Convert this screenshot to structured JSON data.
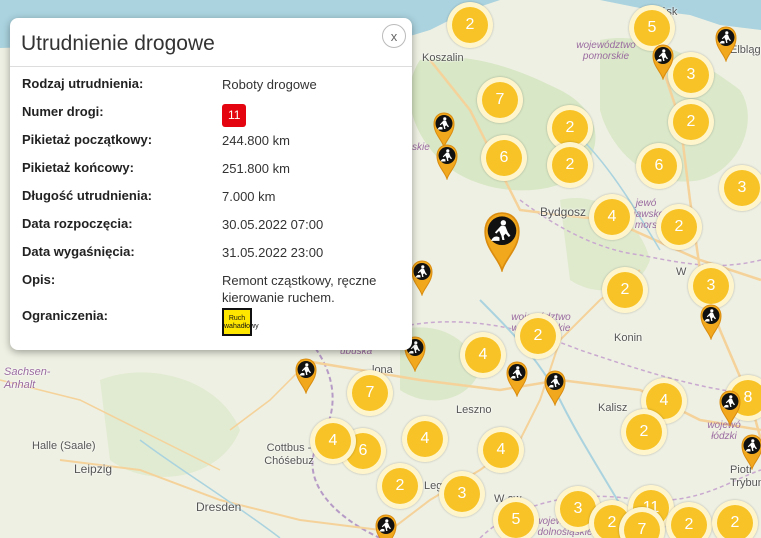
{
  "popup": {
    "title": "Utrudnienie drogowe",
    "close_label": "x",
    "rows": {
      "type_label": "Rodzaj utrudnienia:",
      "type_value": "Roboty drogowe",
      "road_label": "Numer drogi:",
      "road_value": "11",
      "start_km_label": "Pikietaż początkowy:",
      "start_km_value": "244.800 km",
      "end_km_label": "Pikietaż końcowy:",
      "end_km_value": "251.800 km",
      "length_label": "Długość utrudnienia:",
      "length_value": "7.000 km",
      "start_date_label": "Data rozpoczęcia:",
      "start_date_value": "30.05.2022 07:00",
      "end_date_label": "Data wygaśnięcia:",
      "end_date_value": "31.05.2022 23:00",
      "desc_label": "Opis:",
      "desc_value": "Remont cząstkowy, ręczne kierowanie ruchem.",
      "restrictions_label": "Ograniczenia:",
      "restrictions_sign_text": "Ruch wahadłowy"
    }
  },
  "places": {
    "gdansk": "dańsk",
    "elblag": "Elbląg",
    "koszalin": "Koszalin",
    "bydgoszcz": "Bydgosz",
    "konin": "Konin",
    "kalisz": "Kalisz",
    "leszno": "Leszno",
    "zielona": "lona",
    "cottbus": "Cottbus - Chóśebuz",
    "halle": "Halle (Saale)",
    "leipzig": "Leipzig",
    "dresden": "Dresden",
    "sachsen": "Sachsen-Anhalt",
    "piotr": "Piotr Trybun",
    "wlo": "W",
    "leg": "Leg",
    "wroc": "W aw",
    "ubuska": "ubuska",
    "kie": "skie"
  },
  "regions": {
    "pomorskie": "województwo pomorskie",
    "kujawsko": "jewó ujawsko mors",
    "wielkopolskie": "województwo wielkopolskie",
    "lodzkie": "wojewó łódzki",
    "dolnoslaskie": "województwo dolnośląskie"
  },
  "clusters": [
    "2",
    "5",
    "3",
    "7",
    "2",
    "2",
    "6",
    "2",
    "6",
    "3",
    "4",
    "2",
    "2",
    "3",
    "2",
    "4",
    "7",
    "4",
    "4",
    "6",
    "8",
    "4",
    "2",
    "2",
    "4",
    "3",
    "5",
    "3",
    "2",
    "11",
    "7",
    "2",
    "2"
  ],
  "colors": {
    "cluster": "#f7c327",
    "marker": "#f2a81d",
    "road_badge": "#e3040f",
    "water": "#aad3df"
  }
}
